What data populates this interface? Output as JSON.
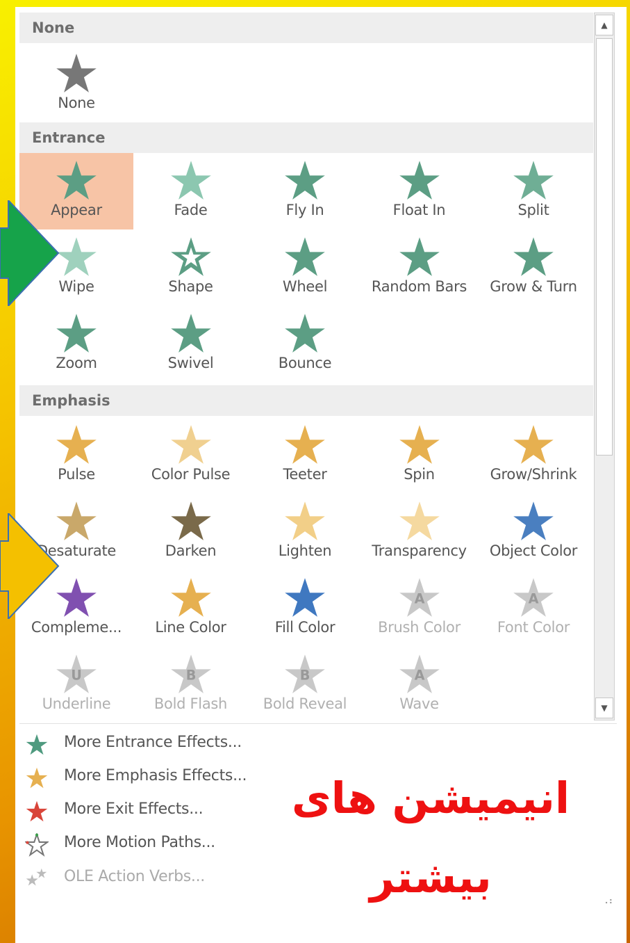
{
  "sections": {
    "none": {
      "header": "None",
      "items": [
        {
          "label": "None"
        }
      ]
    },
    "entrance": {
      "header": "Entrance",
      "items": [
        {
          "label": "Appear"
        },
        {
          "label": "Fade"
        },
        {
          "label": "Fly In"
        },
        {
          "label": "Float In"
        },
        {
          "label": "Split"
        },
        {
          "label": "Wipe"
        },
        {
          "label": "Shape"
        },
        {
          "label": "Wheel"
        },
        {
          "label": "Random Bars"
        },
        {
          "label": "Grow & Turn"
        },
        {
          "label": "Zoom"
        },
        {
          "label": "Swivel"
        },
        {
          "label": "Bounce"
        }
      ]
    },
    "emphasis": {
      "header": "Emphasis",
      "items": [
        {
          "label": "Pulse"
        },
        {
          "label": "Color Pulse"
        },
        {
          "label": "Teeter"
        },
        {
          "label": "Spin"
        },
        {
          "label": "Grow/Shrink"
        },
        {
          "label": "Desaturate"
        },
        {
          "label": "Darken"
        },
        {
          "label": "Lighten"
        },
        {
          "label": "Transparency"
        },
        {
          "label": "Object Color"
        },
        {
          "label": "Compleme..."
        },
        {
          "label": "Line Color"
        },
        {
          "label": "Fill Color"
        },
        {
          "label": "Brush Color"
        },
        {
          "label": "Font Color"
        },
        {
          "label": "Underline"
        },
        {
          "label": "Bold Flash"
        },
        {
          "label": "Bold Reveal"
        },
        {
          "label": "Wave"
        }
      ]
    }
  },
  "more_links": [
    {
      "label": "More Entrance Effects...",
      "icon": "green-star-icon"
    },
    {
      "label": "More Emphasis Effects...",
      "icon": "gold-star-icon"
    },
    {
      "label": "More Exit Effects...",
      "icon": "red-star-icon"
    },
    {
      "label": "More Motion Paths...",
      "icon": "outline-star-icon"
    },
    {
      "label": "OLE Action Verbs...",
      "icon": "gray-stars-icon"
    }
  ],
  "annotation": {
    "line1": "انیمیشن های",
    "line2": "بیشتر"
  },
  "colors": {
    "entrance": "#5c9e84",
    "emphasis": "#e6b050",
    "exit": "#d9453a",
    "selected": "#f7c4a6",
    "annotation": "#ee1111"
  }
}
